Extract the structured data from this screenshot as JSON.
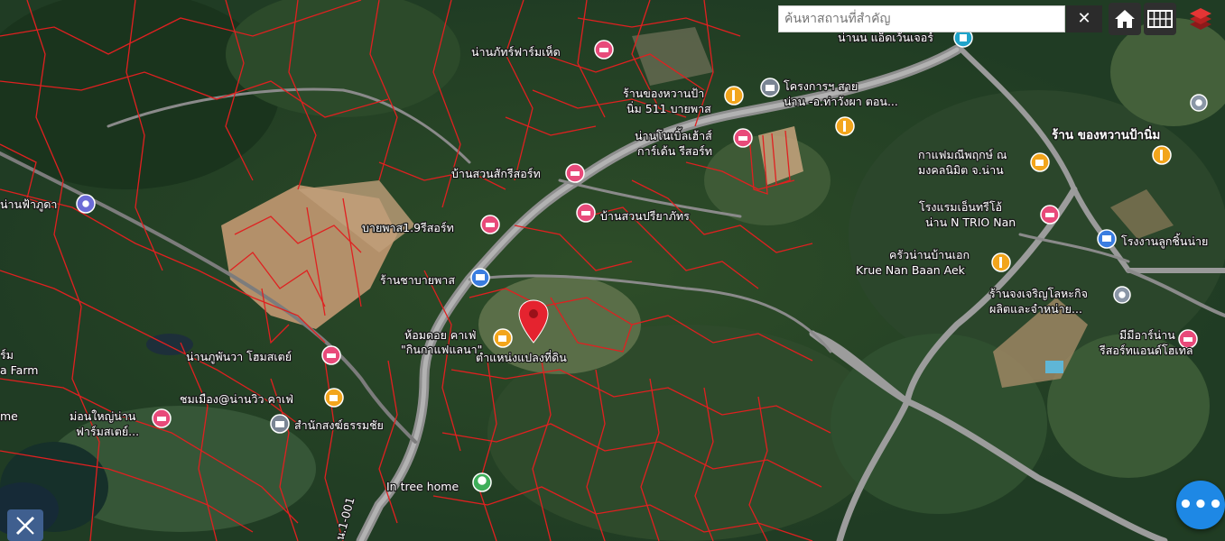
{
  "search": {
    "placeholder": "ค้นหาสถานที่สำคัญ",
    "value": "",
    "clear_label": "✕"
  },
  "controls": {
    "home": "home-icon",
    "grid": "grid-icon",
    "layers": "layers-icon"
  },
  "fab_label": "•••",
  "colors": {
    "parcel": "#e02020",
    "road": "#9a9a9a",
    "marker": "#e5232f",
    "fab": "#1e88e5"
  },
  "labels": {
    "nanphat_farm": "น่านภัทร์ฟาร์มเห็ด",
    "nan_adventure": "น่านน แอ็ดเว้นเจอร์",
    "khong_wan_left_1": "ร้านของหวานป้า",
    "khong_wan_left_2": "นิ่ม 511 บายพาส",
    "project_1": "โครงการฯ สาย",
    "project_2": "น่าน -อ.ท่าวังผา ตอน...",
    "noble_house_1": "น่านโนเบิ้ลเฮ้าส์",
    "noble_house_2": "การ์เด้น รีสอร์ท",
    "khong_wan_right": "ร้าน ของหวานป้านิ่ม",
    "cafe_pruk_1": "กาแฟมณีพฤกษ์ ณ",
    "cafe_pruk_2": "มงคลนิมิต จ.น่าน",
    "suan_sak": "บ้านสวนสักรีสอร์ท",
    "nan_fa_phu": "น่านฟ้าภูดา",
    "ban_suan_priya": "บ้านสวนปรียาภัทร",
    "hotel_trio_1": "โรงแรมเอ็นทรีโอ้",
    "hotel_trio_2": "น่าน N TRIO Nan",
    "bypass_resort": "บายพาส1.9รีสอร์ท",
    "rong_ngan": "โรงงานลูกชิ้นน่าย",
    "krua_1": "ครัวน่านบ้านเอก",
    "krua_2": "Krue Nan Baan Aek",
    "ran_cha": "ร้านชาบายพาส",
    "ran_jong_1": "ร้านจงเจริญโลหะกิจ",
    "ran_jong_2": "ผลิตและจำหน่าย...",
    "hom_doi_1": "ห้อมดอย คาเฟ่",
    "hom_doi_2": "\"กินกาแฟแลนา\"",
    "parcel_location": "ตำแหน่งแปลงที่ดิน",
    "mimi_1": "มีมีอาร์น่าน",
    "mimi_2": "รีสอร์ทแอนด์โฮเทล",
    "nan_phu_phan": "น่านภูพันวา โฮมสเตย์",
    "chom_mueang": "ชมเมือง@น่านวิว คาเฟ่",
    "farm_left_1": "ร์ม",
    "farm_left_2": "a Farm",
    "mon_yai_1": "ม่อนใหญ่น่าน",
    "mon_yai_2": "ฟาร์มสเตย์...",
    "samnak_song": "สำนักสงฆ์ธรรมชัย",
    "home_left": "me",
    "in_tree_home": "In tree home",
    "road_no": "น.1-001"
  }
}
